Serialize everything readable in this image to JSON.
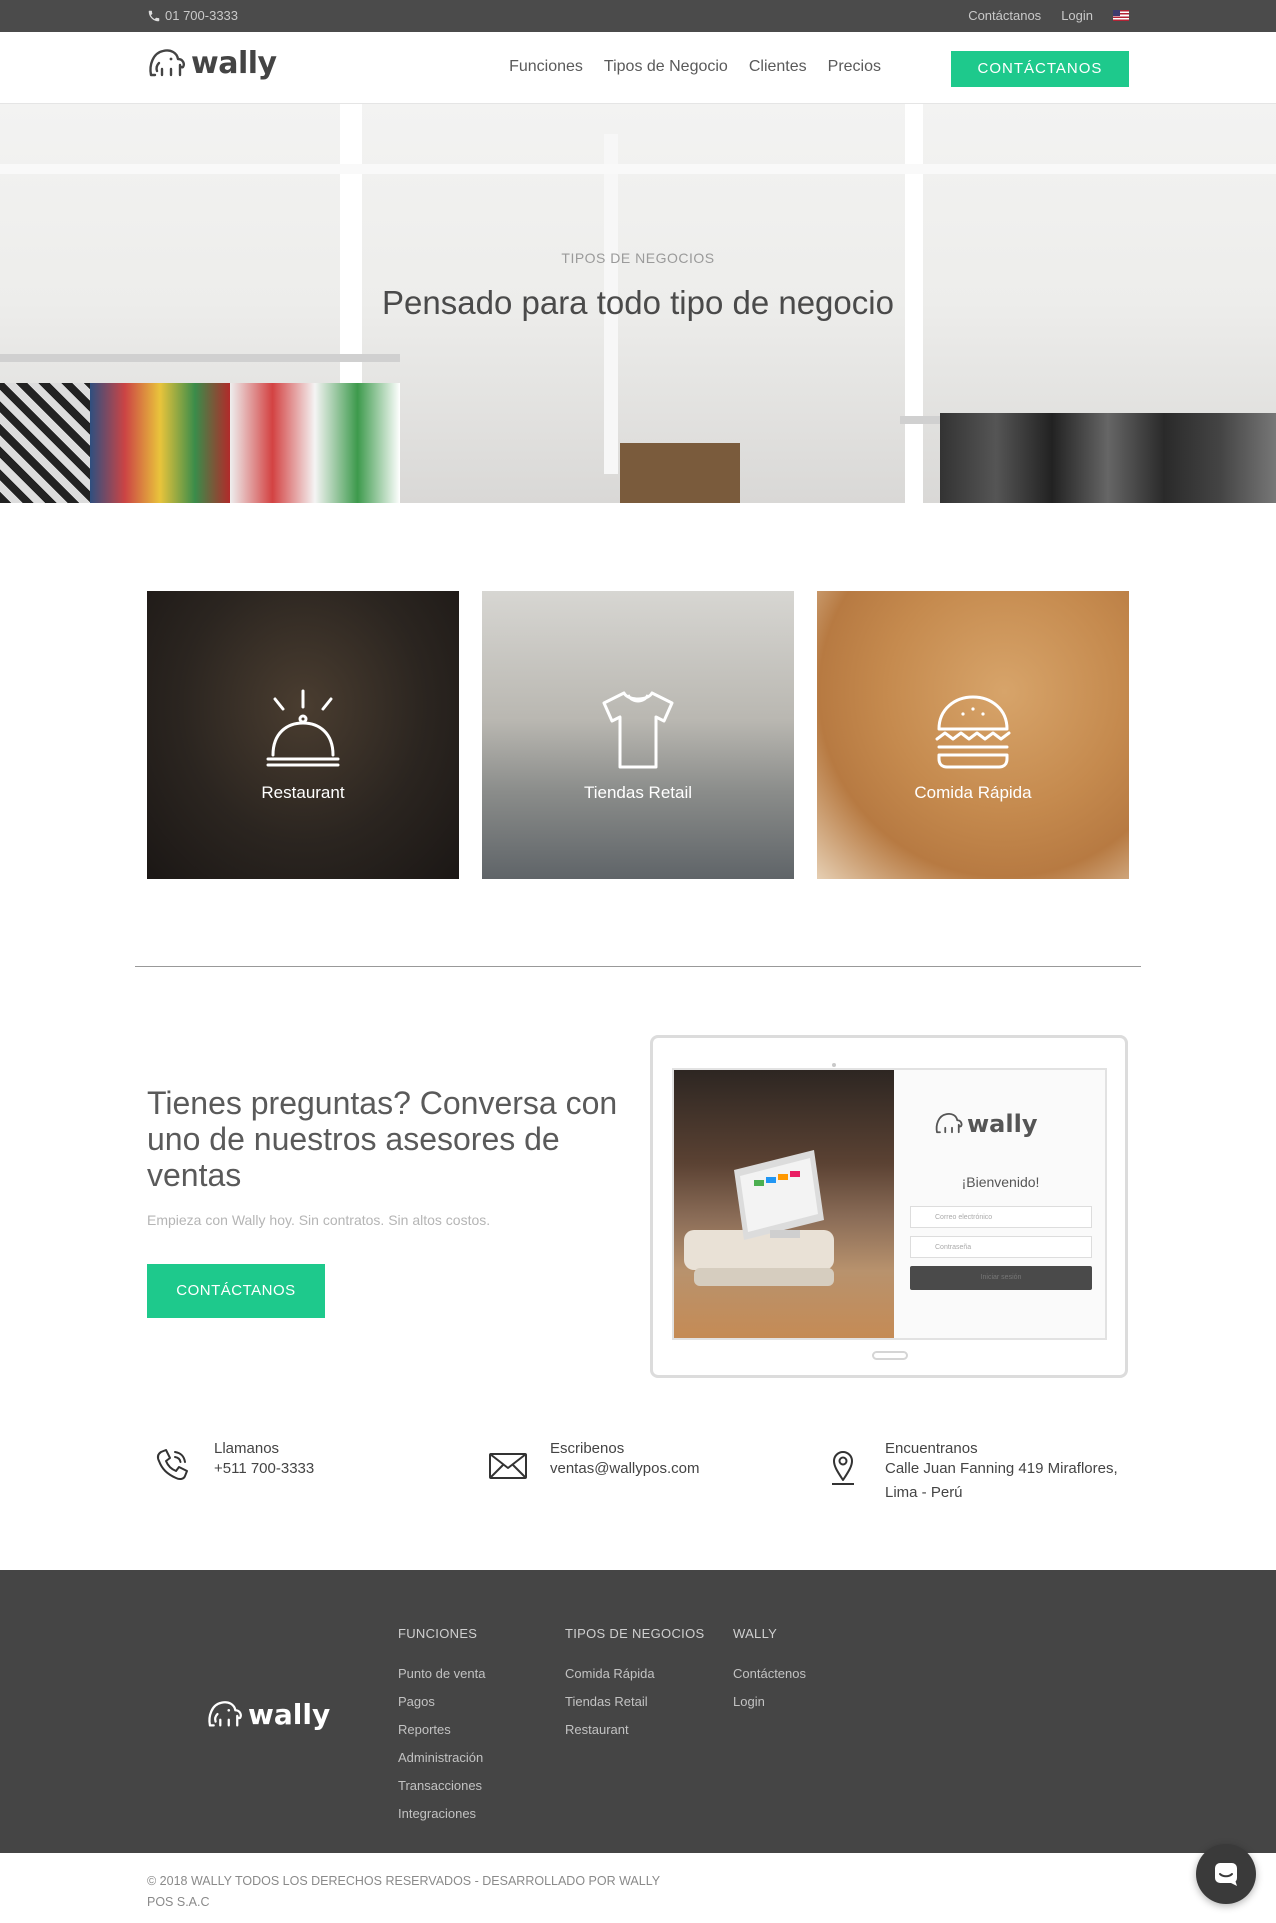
{
  "topbar": {
    "phone": "01 700-3333",
    "contact": "Contáctanos",
    "login": "Login",
    "language_icon": "us-flag-icon"
  },
  "nav": {
    "logo": "wally",
    "items": [
      "Funciones",
      "Tipos de Negocio",
      "Clientes",
      "Precios"
    ],
    "cta": "CONTÁCTANOS"
  },
  "hero": {
    "eyebrow": "TIPOS DE NEGOCIOS",
    "title": "Pensado para todo tipo de negocio"
  },
  "business_types": [
    {
      "label": "Restaurant",
      "icon": "service-bell-icon"
    },
    {
      "label": "Tiendas Retail",
      "icon": "tshirt-icon"
    },
    {
      "label": "Comida Rápida",
      "icon": "burger-icon"
    }
  ],
  "contact": {
    "title": "Tienes preguntas? Conversa con uno de nuestros asesores de ventas",
    "subtitle": "Empieza con Wally hoy. Sin contratos. Sin altos costos.",
    "button": "CONTÁCTANOS",
    "tablet": {
      "logo": "wally",
      "welcome": "¡Bienvenido!",
      "email_placeholder": "Correo electrónico",
      "password_placeholder": "Contraseña",
      "submit": "Iniciar sesión"
    }
  },
  "info": [
    {
      "title": "Llamanos",
      "value": "+511 700-3333",
      "icon": "phone-icon"
    },
    {
      "title": "Escribenos",
      "value": "ventas@wallypos.com",
      "icon": "envelope-icon"
    },
    {
      "title": "Encuentranos",
      "value": "Calle Juan Fanning 419 Miraflores, Lima - Perú",
      "icon": "map-pin-icon"
    }
  ],
  "footer": {
    "logo": "wally",
    "columns": [
      {
        "heading": "FUNCIONES",
        "links": [
          "Punto de venta",
          "Pagos",
          "Reportes",
          "Administración",
          "Transacciones",
          "Integraciones"
        ]
      },
      {
        "heading": "TIPOS DE NEGOCIOS",
        "links": [
          "Comida Rápida",
          "Tiendas Retail",
          "Restaurant"
        ]
      },
      {
        "heading": "WALLY",
        "links": [
          "Contáctenos",
          "Login"
        ]
      }
    ],
    "copyright": "© 2018 WALLY TODOS LOS DERECHOS RESERVADOS - DESARROLLADO POR WALLY POS S.A.C"
  },
  "colors": {
    "accent": "#1ec98c",
    "topbar": "#4b4b4b",
    "footer": "#454545"
  },
  "chat_icon": "chat-bubble-icon"
}
